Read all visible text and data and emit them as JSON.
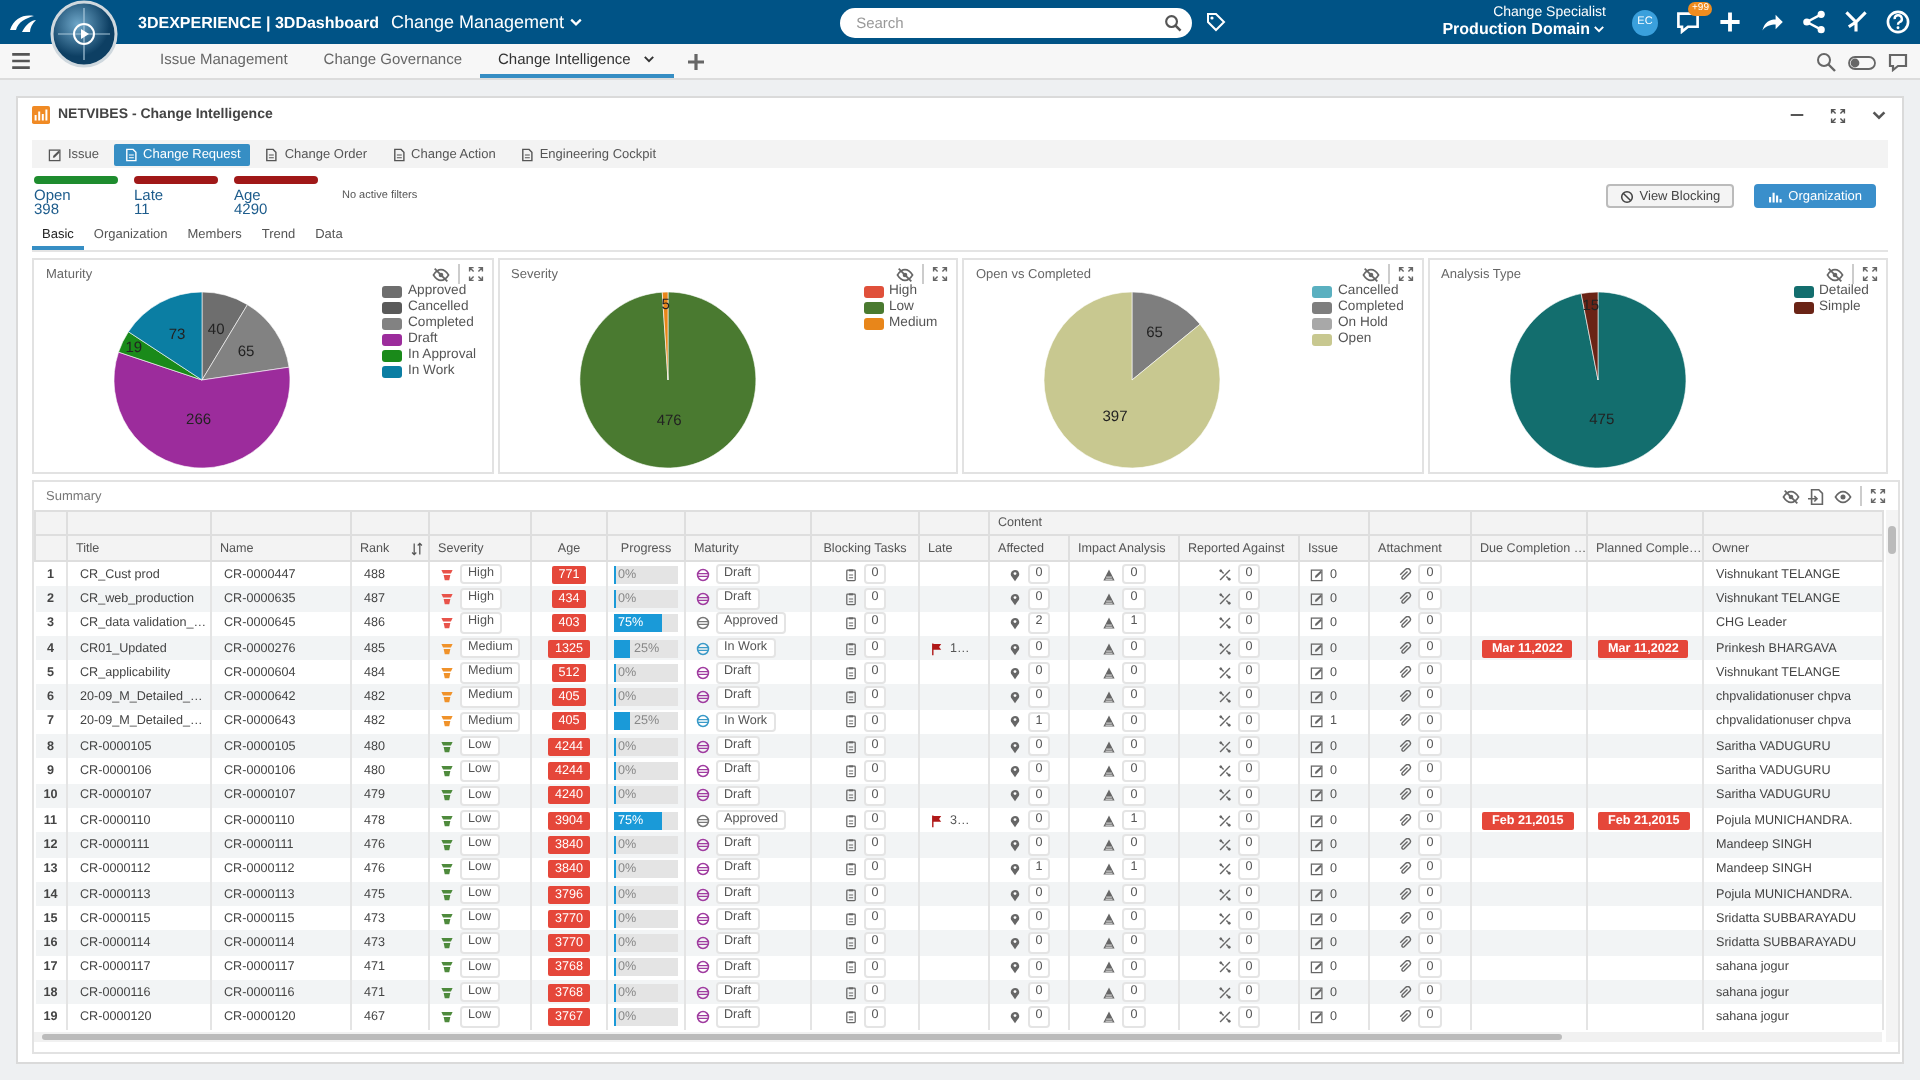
{
  "top_bar": {
    "brand": "3DEXPERIENCE | 3DDashboard",
    "app_title": "Change Management",
    "search_placeholder": "Search",
    "role": "Change Specialist",
    "domain": "Production Domain",
    "avatar": "EC",
    "notification_badge": "+99"
  },
  "dashboard_tabs": [
    {
      "label": "Issue Management",
      "selected": false
    },
    {
      "label": "Change Governance",
      "selected": false
    },
    {
      "label": "Change Intelligence",
      "selected": true
    }
  ],
  "widget": {
    "title": "NETVIBES - Change Intelligence",
    "modules": [
      {
        "label": "Issue",
        "selected": false
      },
      {
        "label": "Change Request",
        "selected": true
      },
      {
        "label": "Change Order",
        "selected": false
      },
      {
        "label": "Change Action",
        "selected": false
      },
      {
        "label": "Engineering Cockpit",
        "selected": false
      }
    ],
    "kpis": [
      {
        "label": "Open",
        "value": "398",
        "color": "#1e8c2e"
      },
      {
        "label": "Late",
        "value": "11",
        "color": "#a01818"
      },
      {
        "label": "Age",
        "value": "4290",
        "color": "#a01818"
      }
    ],
    "filter_note": "No active filters",
    "buttons": [
      {
        "label": "View Blocking",
        "kind": "plain"
      },
      {
        "label": "Organization",
        "kind": "primary"
      }
    ],
    "views": [
      {
        "label": "Basic",
        "selected": true
      },
      {
        "label": "Organization",
        "selected": false
      },
      {
        "label": "Members",
        "selected": false
      },
      {
        "label": "Trend",
        "selected": false
      },
      {
        "label": "Data",
        "selected": false
      }
    ],
    "charts": [
      {
        "title": "Maturity",
        "legend": [
          {
            "color": "#6e6e6e"
          },
          {
            "color": "#5a5a5a"
          },
          {
            "color": "#828282"
          },
          {
            "color": "#9c2c9c"
          },
          {
            "color": "#1a8a1a"
          },
          {
            "color": "#0b7ea3"
          }
        ],
        "chart_data": {
          "type": "pie",
          "categories": [
            "Approved",
            "Cancelled",
            "Completed",
            "Draft",
            "In Approval",
            "In Work"
          ],
          "values": [
            40,
            null,
            65,
            266,
            19,
            73
          ],
          "data_labels": true
        }
      },
      {
        "title": "Severity",
        "legend": [
          {
            "color": "#e0503a"
          },
          {
            "color": "#4a7a30"
          },
          {
            "color": "#e8861a"
          }
        ],
        "chart_data": {
          "type": "pie",
          "categories": [
            "High",
            "Low",
            "Medium"
          ],
          "values": [
            null,
            476,
            5
          ],
          "data_labels": true
        }
      },
      {
        "title": "Open vs Completed",
        "legend": [
          {
            "color": "#5ab0c0"
          },
          {
            "color": "#7e7e7e"
          },
          {
            "color": "#a8a8a8"
          },
          {
            "color": "#c8c890"
          }
        ],
        "chart_data": {
          "type": "pie",
          "categories": [
            "Cancelled",
            "Completed",
            "On Hold",
            "Open"
          ],
          "values": [
            null,
            65,
            null,
            397
          ],
          "data_labels": true
        }
      },
      {
        "title": "Analysis Type",
        "legend": [
          {
            "color": "#136e6e"
          },
          {
            "color": "#6a2416"
          }
        ],
        "chart_data": {
          "type": "pie",
          "categories": [
            "Detailed",
            "Simple"
          ],
          "values": [
            475,
            15
          ],
          "data_labels": true
        }
      }
    ],
    "summary": {
      "title": "Summary",
      "group_header": "Content",
      "columns": [
        "Title",
        "Name",
        "Rank",
        "Severity",
        "Age",
        "Progress",
        "Maturity",
        "Blocking Tasks",
        "Late",
        "Affected",
        "Impact Analysis",
        "Reported Against",
        "Issue",
        "Attachment",
        "Due Completion …",
        "Planned Comple…",
        "Owner"
      ],
      "rows": [
        {
          "number": "1",
          "title": "CR_Cust prod",
          "name": "CR-0000447",
          "rank": "488",
          "severity": {
            "label": "High",
            "color": "#e8534a"
          },
          "age": "771",
          "progress": {
            "label": "0%",
            "level": 0
          },
          "maturity": {
            "label": "Draft",
            "color": "#a03ca0"
          },
          "blocking": "0",
          "affected": "0",
          "impact": "0",
          "reported": "0",
          "issue": "0",
          "attachment": "0",
          "owner": "Vishnukant TELANGE"
        },
        {
          "number": "2",
          "title": "CR_web_production",
          "name": "CR-0000635",
          "rank": "487",
          "severity": {
            "label": "High",
            "color": "#e8534a"
          },
          "age": "434",
          "progress": {
            "label": "0%",
            "level": 0
          },
          "maturity": {
            "label": "Draft",
            "color": "#a03ca0"
          },
          "blocking": "0",
          "affected": "0",
          "impact": "0",
          "reported": "0",
          "issue": "0",
          "attachment": "0",
          "owner": "Vishnukant TELANGE"
        },
        {
          "number": "3",
          "title": "CR_data validation_…",
          "name": "CR-0000645",
          "rank": "486",
          "severity": {
            "label": "High",
            "color": "#e8534a"
          },
          "age": "403",
          "progress": {
            "label": "75%",
            "level": 0.75
          },
          "maturity": {
            "label": "Approved",
            "color": "#777777"
          },
          "blocking": "0",
          "affected": "2",
          "impact": "1",
          "reported": "0",
          "issue": "0",
          "attachment": "0",
          "owner": "CHG Leader"
        },
        {
          "number": "4",
          "title": "CR01_Updated",
          "name": "CR-0000276",
          "rank": "485",
          "severity": {
            "label": "Medium",
            "color": "#f0922a"
          },
          "age": "1325",
          "progress": {
            "label": "25%",
            "level": 0.25
          },
          "maturity": {
            "label": "In Work",
            "color": "#3a9ac8"
          },
          "blocking": "0",
          "late": "1…",
          "affected": "0",
          "impact": "0",
          "reported": "0",
          "issue": "0",
          "attachment": "0",
          "due": "Mar 11,2022",
          "planned": "Mar 11,2022",
          "owner": "Prinkesh BHARGAVA"
        },
        {
          "number": "5",
          "title": "CR_applicability",
          "name": "CR-0000604",
          "rank": "484",
          "severity": {
            "label": "Medium",
            "color": "#f0922a"
          },
          "age": "512",
          "progress": {
            "label": "0%",
            "level": 0
          },
          "maturity": {
            "label": "Draft",
            "color": "#a03ca0"
          },
          "blocking": "0",
          "affected": "0",
          "impact": "0",
          "reported": "0",
          "issue": "0",
          "attachment": "0",
          "owner": "Vishnukant TELANGE"
        },
        {
          "number": "6",
          "title": "20-09_M_Detailed_…",
          "name": "CR-0000642",
          "rank": "482",
          "severity": {
            "label": "Medium",
            "color": "#f0922a"
          },
          "age": "405",
          "progress": {
            "label": "0%",
            "level": 0
          },
          "maturity": {
            "label": "Draft",
            "color": "#a03ca0"
          },
          "blocking": "0",
          "affected": "0",
          "impact": "0",
          "reported": "0",
          "issue": "0",
          "attachment": "0",
          "owner": "chpvalidationuser chpva"
        },
        {
          "number": "7",
          "title": "20-09_M_Detailed_…",
          "name": "CR-0000643",
          "rank": "482",
          "severity": {
            "label": "Medium",
            "color": "#f0922a"
          },
          "age": "405",
          "progress": {
            "label": "25%",
            "level": 0.25
          },
          "maturity": {
            "label": "In Work",
            "color": "#3a9ac8"
          },
          "blocking": "0",
          "affected": "1",
          "impact": "0",
          "reported": "0",
          "issue": "1",
          "attachment": "0",
          "owner": "chpvalidationuser chpva"
        },
        {
          "number": "8",
          "title": "CR-0000105",
          "name": "CR-0000105",
          "rank": "480",
          "severity": {
            "label": "Low",
            "color": "#4e8a3c"
          },
          "age": "4244",
          "progress": {
            "label": "0%",
            "level": 0
          },
          "maturity": {
            "label": "Draft",
            "color": "#a03ca0"
          },
          "blocking": "0",
          "affected": "0",
          "impact": "0",
          "reported": "0",
          "issue": "0",
          "attachment": "0",
          "owner": "Saritha VADUGURU"
        },
        {
          "number": "9",
          "title": "CR-0000106",
          "name": "CR-0000106",
          "rank": "480",
          "severity": {
            "label": "Low",
            "color": "#4e8a3c"
          },
          "age": "4244",
          "progress": {
            "label": "0%",
            "level": 0
          },
          "maturity": {
            "label": "Draft",
            "color": "#a03ca0"
          },
          "blocking": "0",
          "affected": "0",
          "impact": "0",
          "reported": "0",
          "issue": "0",
          "attachment": "0",
          "owner": "Saritha VADUGURU"
        },
        {
          "number": "10",
          "title": "CR-0000107",
          "name": "CR-0000107",
          "rank": "479",
          "severity": {
            "label": "Low",
            "color": "#4e8a3c"
          },
          "age": "4240",
          "progress": {
            "label": "0%",
            "level": 0
          },
          "maturity": {
            "label": "Draft",
            "color": "#a03ca0"
          },
          "blocking": "0",
          "affected": "0",
          "impact": "0",
          "reported": "0",
          "issue": "0",
          "attachment": "0",
          "owner": "Saritha VADUGURU"
        },
        {
          "number": "11",
          "title": "CR-0000110",
          "name": "CR-0000110",
          "rank": "478",
          "severity": {
            "label": "Low",
            "color": "#4e8a3c"
          },
          "age": "3904",
          "progress": {
            "label": "75%",
            "level": 0.75
          },
          "maturity": {
            "label": "Approved",
            "color": "#777777"
          },
          "blocking": "0",
          "late": "3…",
          "affected": "0",
          "impact": "1",
          "reported": "0",
          "issue": "0",
          "attachment": "0",
          "due": "Feb 21,2015",
          "planned": "Feb 21,2015",
          "owner": "Pojula MUNICHANDRA."
        },
        {
          "number": "12",
          "title": "CR-0000111",
          "name": "CR-0000111",
          "rank": "476",
          "severity": {
            "label": "Low",
            "color": "#4e8a3c"
          },
          "age": "3840",
          "progress": {
            "label": "0%",
            "level": 0
          },
          "maturity": {
            "label": "Draft",
            "color": "#a03ca0"
          },
          "blocking": "0",
          "affected": "0",
          "impact": "0",
          "reported": "0",
          "issue": "0",
          "attachment": "0",
          "owner": "Mandeep SINGH"
        },
        {
          "number": "13",
          "title": "CR-0000112",
          "name": "CR-0000112",
          "rank": "476",
          "severity": {
            "label": "Low",
            "color": "#4e8a3c"
          },
          "age": "3840",
          "progress": {
            "label": "0%",
            "level": 0
          },
          "maturity": {
            "label": "Draft",
            "color": "#a03ca0"
          },
          "blocking": "0",
          "affected": "1",
          "impact": "1",
          "reported": "0",
          "issue": "0",
          "attachment": "0",
          "owner": "Mandeep SINGH"
        },
        {
          "number": "14",
          "title": "CR-0000113",
          "name": "CR-0000113",
          "rank": "475",
          "severity": {
            "label": "Low",
            "color": "#4e8a3c"
          },
          "age": "3796",
          "progress": {
            "label": "0%",
            "level": 0
          },
          "maturity": {
            "label": "Draft",
            "color": "#a03ca0"
          },
          "blocking": "0",
          "affected": "0",
          "impact": "0",
          "reported": "0",
          "issue": "0",
          "attachment": "0",
          "owner": "Pojula MUNICHANDRA."
        },
        {
          "number": "15",
          "title": "CR-0000115",
          "name": "CR-0000115",
          "rank": "473",
          "severity": {
            "label": "Low",
            "color": "#4e8a3c"
          },
          "age": "3770",
          "progress": {
            "label": "0%",
            "level": 0
          },
          "maturity": {
            "label": "Draft",
            "color": "#a03ca0"
          },
          "blocking": "0",
          "affected": "0",
          "impact": "0",
          "reported": "0",
          "issue": "0",
          "attachment": "0",
          "owner": "Sridatta SUBBARAYADU"
        },
        {
          "number": "16",
          "title": "CR-0000114",
          "name": "CR-0000114",
          "rank": "473",
          "severity": {
            "label": "Low",
            "color": "#4e8a3c"
          },
          "age": "3770",
          "progress": {
            "label": "0%",
            "level": 0
          },
          "maturity": {
            "label": "Draft",
            "color": "#a03ca0"
          },
          "blocking": "0",
          "affected": "0",
          "impact": "0",
          "reported": "0",
          "issue": "0",
          "attachment": "0",
          "owner": "Sridatta SUBBARAYADU"
        },
        {
          "number": "17",
          "title": "CR-0000117",
          "name": "CR-0000117",
          "rank": "471",
          "severity": {
            "label": "Low",
            "color": "#4e8a3c"
          },
          "age": "3768",
          "progress": {
            "label": "0%",
            "level": 0
          },
          "maturity": {
            "label": "Draft",
            "color": "#a03ca0"
          },
          "blocking": "0",
          "affected": "0",
          "impact": "0",
          "reported": "0",
          "issue": "0",
          "attachment": "0",
          "owner": "sahana jogur"
        },
        {
          "number": "18",
          "title": "CR-0000116",
          "name": "CR-0000116",
          "rank": "471",
          "severity": {
            "label": "Low",
            "color": "#4e8a3c"
          },
          "age": "3768",
          "progress": {
            "label": "0%",
            "level": 0
          },
          "maturity": {
            "label": "Draft",
            "color": "#a03ca0"
          },
          "blocking": "0",
          "affected": "0",
          "impact": "0",
          "reported": "0",
          "issue": "0",
          "attachment": "0",
          "owner": "sahana jogur"
        },
        {
          "number": "19",
          "title": "CR-0000120",
          "name": "CR-0000120",
          "rank": "467",
          "severity": {
            "label": "Low",
            "color": "#4e8a3c"
          },
          "age": "3767",
          "progress": {
            "label": "0%",
            "level": 0
          },
          "maturity": {
            "label": "Draft",
            "color": "#a03ca0"
          },
          "blocking": "0",
          "affected": "0",
          "impact": "0",
          "reported": "0",
          "issue": "0",
          "attachment": "0",
          "owner": "sahana jogur"
        }
      ]
    }
  }
}
